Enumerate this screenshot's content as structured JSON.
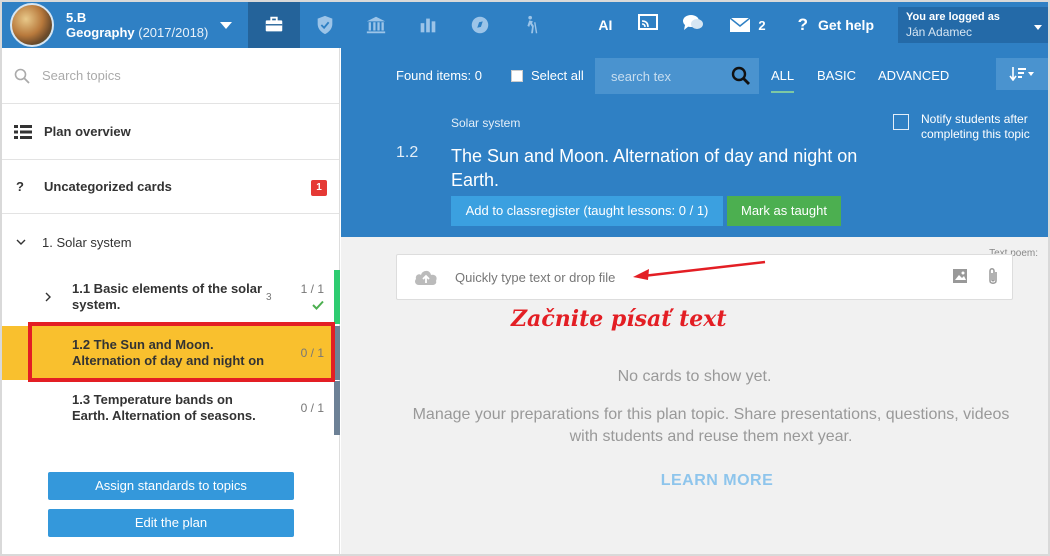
{
  "header": {
    "class_name": "5.B",
    "subject": "Geography",
    "year": "(2017/2018)",
    "ai_label": "AI",
    "messages_count": "2",
    "help_label": "Get help",
    "logged_as": "You are logged as",
    "user_name": "Ján Adamec"
  },
  "sidebar": {
    "search_placeholder": "Search topics",
    "plan_overview": "Plan overview",
    "uncategorized_marker": "?",
    "uncategorized": "Uncategorized cards",
    "uncategorized_badge": "1",
    "section": "1. Solar system",
    "topics": [
      {
        "title": "1.1 Basic elements of the solar system.",
        "sub": "3",
        "count": "1 / 1"
      },
      {
        "title": "1.2 The Sun and Moon. Alternation of day and night on",
        "count": "0 / 1"
      },
      {
        "title": "1.3 Temperature bands on Earth. Alternation of seasons.",
        "count": "0 / 1"
      }
    ],
    "assign_button": "Assign standards to topics",
    "edit_button": "Edit the plan"
  },
  "filters": {
    "found": "Found items: 0",
    "select_all": "Select all",
    "search_placeholder": "search tex",
    "tabs": [
      "ALL",
      "BASIC",
      "ADVANCED"
    ]
  },
  "topic": {
    "breadcrumb": "Solar system",
    "number": "1.2",
    "title": "The Sun and Moon. Alternation of day and night on Earth.",
    "notify": "Notify students after completing this topic",
    "add_button": "Add to classregister (taught lessons: 0 / 1)",
    "mark_button": "Mark as taught"
  },
  "composer": {
    "peek": "Text poem:",
    "placeholder": "Quickly type text or drop file",
    "annotation": "Začnite písať text"
  },
  "empty": {
    "line1": "No cards to show yet.",
    "line2": "Manage your preparations for this plan topic. Share presentations, questions, videos with students and reuse them next year.",
    "learn_more": "LEARN MORE"
  },
  "colors": {
    "primary": "#2f80c4",
    "selected": "#f9c02e",
    "highlight": "#e31e24",
    "success": "#4caf50"
  }
}
